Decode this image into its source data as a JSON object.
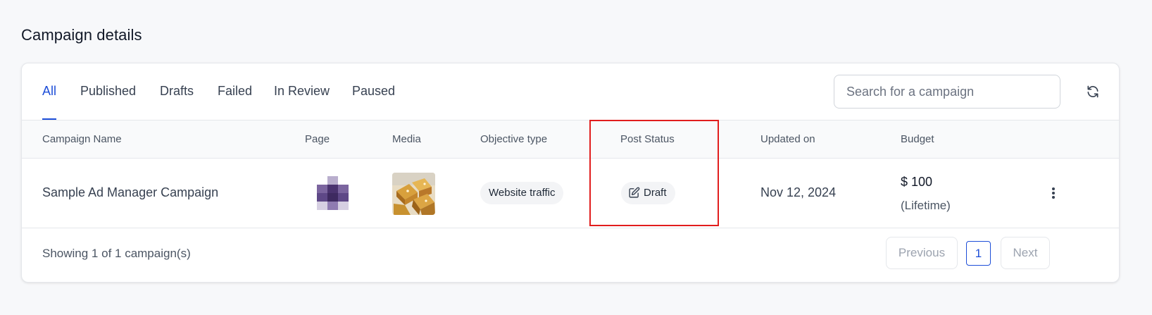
{
  "page": {
    "title": "Campaign details"
  },
  "tabs": [
    {
      "label": "All",
      "active": true
    },
    {
      "label": "Published",
      "active": false
    },
    {
      "label": "Drafts",
      "active": false
    },
    {
      "label": "Failed",
      "active": false
    },
    {
      "label": "In Review",
      "active": false
    },
    {
      "label": "Paused",
      "active": false
    }
  ],
  "search": {
    "placeholder": "Search for a campaign",
    "value": ""
  },
  "toolbar": {
    "refresh_icon": "refresh-icon"
  },
  "table": {
    "columns": [
      "Campaign Name",
      "Page",
      "Media",
      "Objective type",
      "Post Status",
      "Updated on",
      "Budget"
    ],
    "rows": [
      {
        "name": "Sample Ad Manager Campaign",
        "page_icon": "page-avatar-blurred",
        "media_icon": "gold-boxes-thumbnail",
        "objective": "Website traffic",
        "status": "Draft",
        "status_icon": "edit-icon",
        "updated": "Nov 12, 2024",
        "budget_amount": "$ 100",
        "budget_period": "(Lifetime)"
      }
    ]
  },
  "footer": {
    "showing": "Showing 1 of 1 campaign(s)",
    "previous_label": "Previous",
    "page_number": "1",
    "next_label": "Next"
  },
  "colors": {
    "accent": "#1d4ed8",
    "highlight": "#e11d1d",
    "pill_background": "#f3f4f6"
  }
}
